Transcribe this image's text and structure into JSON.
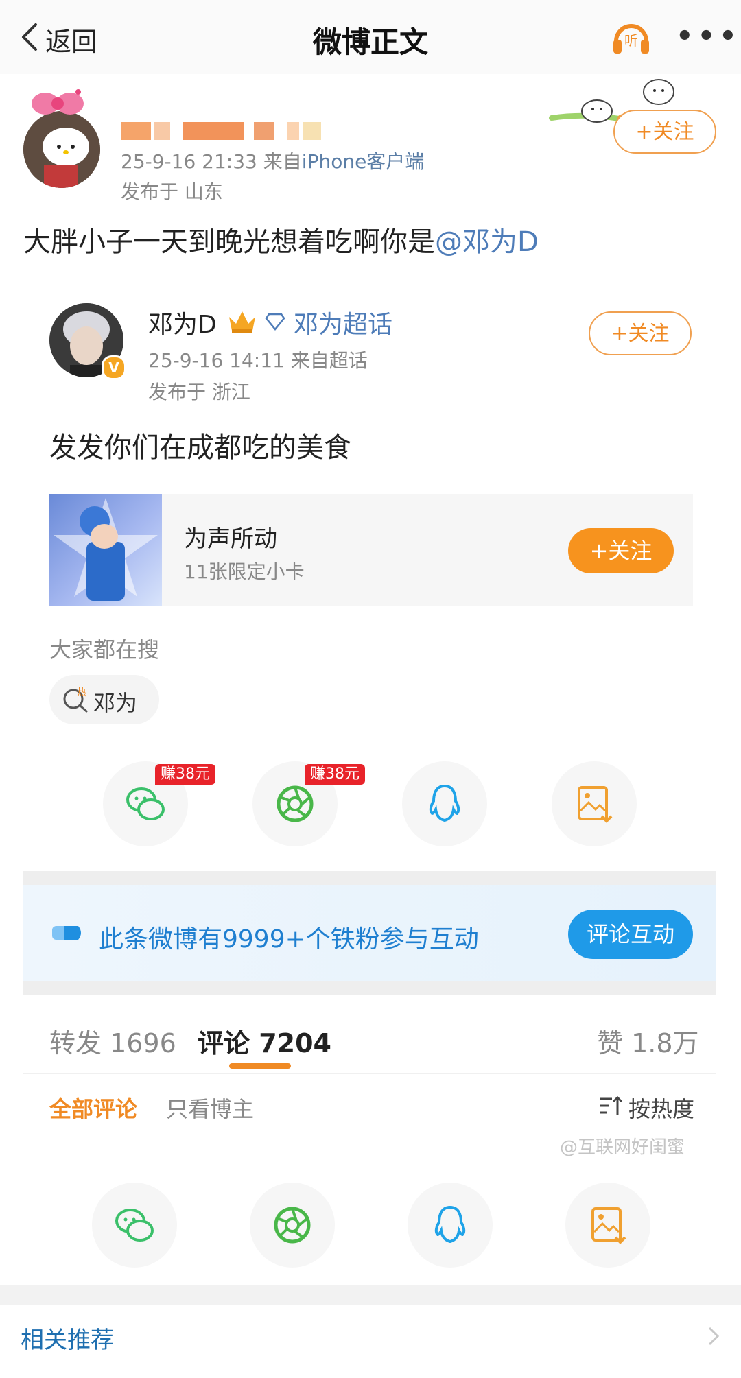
{
  "header": {
    "back_label": "返回",
    "title": "微博正文",
    "listen_label": "听",
    "more_label": "•••"
  },
  "post": {
    "time": "25-9-16 21:33",
    "source_prefix": "来自",
    "source": "iPhone客户端",
    "location": "发布于 山东",
    "follow_label": "+关注",
    "text": "大胖小子一天到晚光想着吃啊你是",
    "mention": "@邓为D"
  },
  "retweet": {
    "username": "邓为D",
    "topic": "邓为超话",
    "time": "25-9-16 14:11",
    "source": "来自超话",
    "location": "发布于 浙江",
    "follow_label": "+关注",
    "text": "发发你们在成都吃的美食",
    "card": {
      "title": "为声所动",
      "subtitle": "11张限定小卡",
      "button": "+关注"
    },
    "search": {
      "heading": "大家都在搜",
      "chip": "邓为",
      "chip_badge": "热"
    }
  },
  "share_row": {
    "reward_label": "赚38元",
    "items": [
      "wechat-icon",
      "moments-icon",
      "qq-icon",
      "save-image-icon"
    ]
  },
  "banner": {
    "text": "此条微博有9999+个铁粉参与互动",
    "button": "评论互动"
  },
  "tabs": {
    "repost": "转发 1696",
    "comment": "评论 7204",
    "like": "赞 1.8万"
  },
  "filters": {
    "all": "全部评论",
    "author_only": "只看博主",
    "sort": "按热度"
  },
  "watermark": "@互联网好闺蜜",
  "related": {
    "label": "相关推荐"
  },
  "colors": {
    "accent_orange": "#f08a24",
    "link_blue": "#4e7cb8",
    "banner_blue": "#1f9ae8",
    "reward_red": "#e8232a"
  }
}
